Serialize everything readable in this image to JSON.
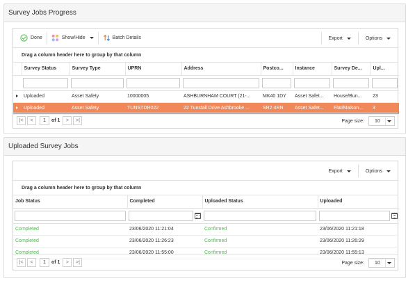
{
  "progress": {
    "title": "Survey Jobs Progress",
    "toolbar": {
      "done": "Done",
      "show_hide": "Show/Hide",
      "batch": "Batch Details",
      "export": "Export",
      "options": "Options"
    },
    "group_hint": "Drag a column header here to group by that column",
    "columns": [
      "Survey Status",
      "Survey Type",
      "UPRN",
      "Address",
      "Postco...",
      "Instance",
      "Survey De...",
      "Upl..."
    ],
    "rows": [
      [
        "Uploaded",
        "Asset Safety",
        "10000005",
        "ASHBURNHAM COURT (21-...",
        "MK40 1DY",
        "Asset Safet...",
        "House/Bun...",
        "23"
      ],
      [
        "Uploaded",
        "Asset Safety",
        "TUNSTDR022",
        "22 Tunstall Drive Ashbrooke ...",
        "SR2 4RN",
        "Asset Safet...",
        "Flat/Maison...",
        "3"
      ]
    ],
    "pager": {
      "page": "1",
      "of": "of 1",
      "size_label": "Page size:",
      "size": "10"
    }
  },
  "uploaded": {
    "title": "Uploaded Survey Jobs",
    "toolbar": {
      "export": "Export",
      "options": "Options"
    },
    "group_hint": "Drag a column header here to group by that column",
    "columns": [
      "Job Status",
      "Completed",
      "Uploaded Status",
      "Uploaded"
    ],
    "rows": [
      [
        "Completed",
        "23/06/2020 11:21:04",
        "Confirmed",
        "23/06/2020 11:21:18"
      ],
      [
        "Completed",
        "23/06/2020 11:26:23",
        "Confirmed",
        "23/06/2020 11:26:29"
      ],
      [
        "Completed",
        "23/06/2020 11:55:00",
        "Confirmed",
        "23/06/2020 11:55:13"
      ]
    ],
    "pager": {
      "page": "1",
      "of": "of 1",
      "size_label": "Page size:",
      "size": "10"
    }
  },
  "colors": {
    "selected_row": "#f0885a",
    "status_green": "#3fc43f",
    "done_icon": "#5cb85c"
  }
}
